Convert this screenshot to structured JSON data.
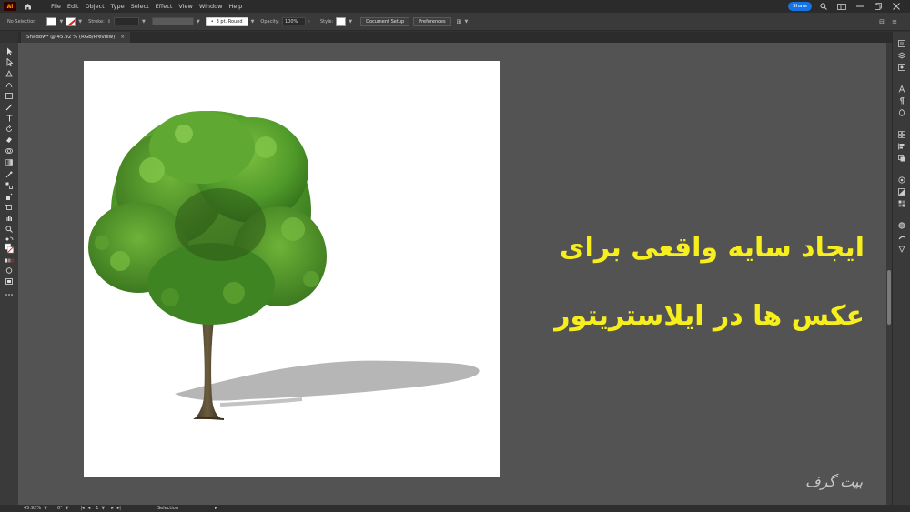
{
  "app": {
    "logo_text": "Ai"
  },
  "menu": [
    "File",
    "Edit",
    "Object",
    "Type",
    "Select",
    "Effect",
    "View",
    "Window",
    "Help"
  ],
  "menubar_right": {
    "share_label": "Share"
  },
  "control": {
    "selection_label": "No Selection",
    "stroke_label": "Stroke:",
    "brush_value": "3 pt. Round",
    "opacity_label": "Opacity:",
    "opacity_value": "100%",
    "style_label": "Style:",
    "document_setup_label": "Document Setup",
    "preferences_label": "Preferences"
  },
  "document_tab": {
    "title": "Shadow* @ 45.92 % (RGB/Preview)",
    "close_glyph": "×"
  },
  "overlay": {
    "line1": "ایجاد سایه واقعی برای",
    "line2": "عکس ها در ایلاستریتور",
    "text_color": "#f7ee1d",
    "watermark": "بیت گرف"
  },
  "status": {
    "zoom_value": "45.92%",
    "rotation_value": "0°",
    "artboard_number": "1",
    "tool_name": "Selection"
  },
  "colors": {
    "accent": "#1473e6",
    "brand": "#ff9a00"
  }
}
